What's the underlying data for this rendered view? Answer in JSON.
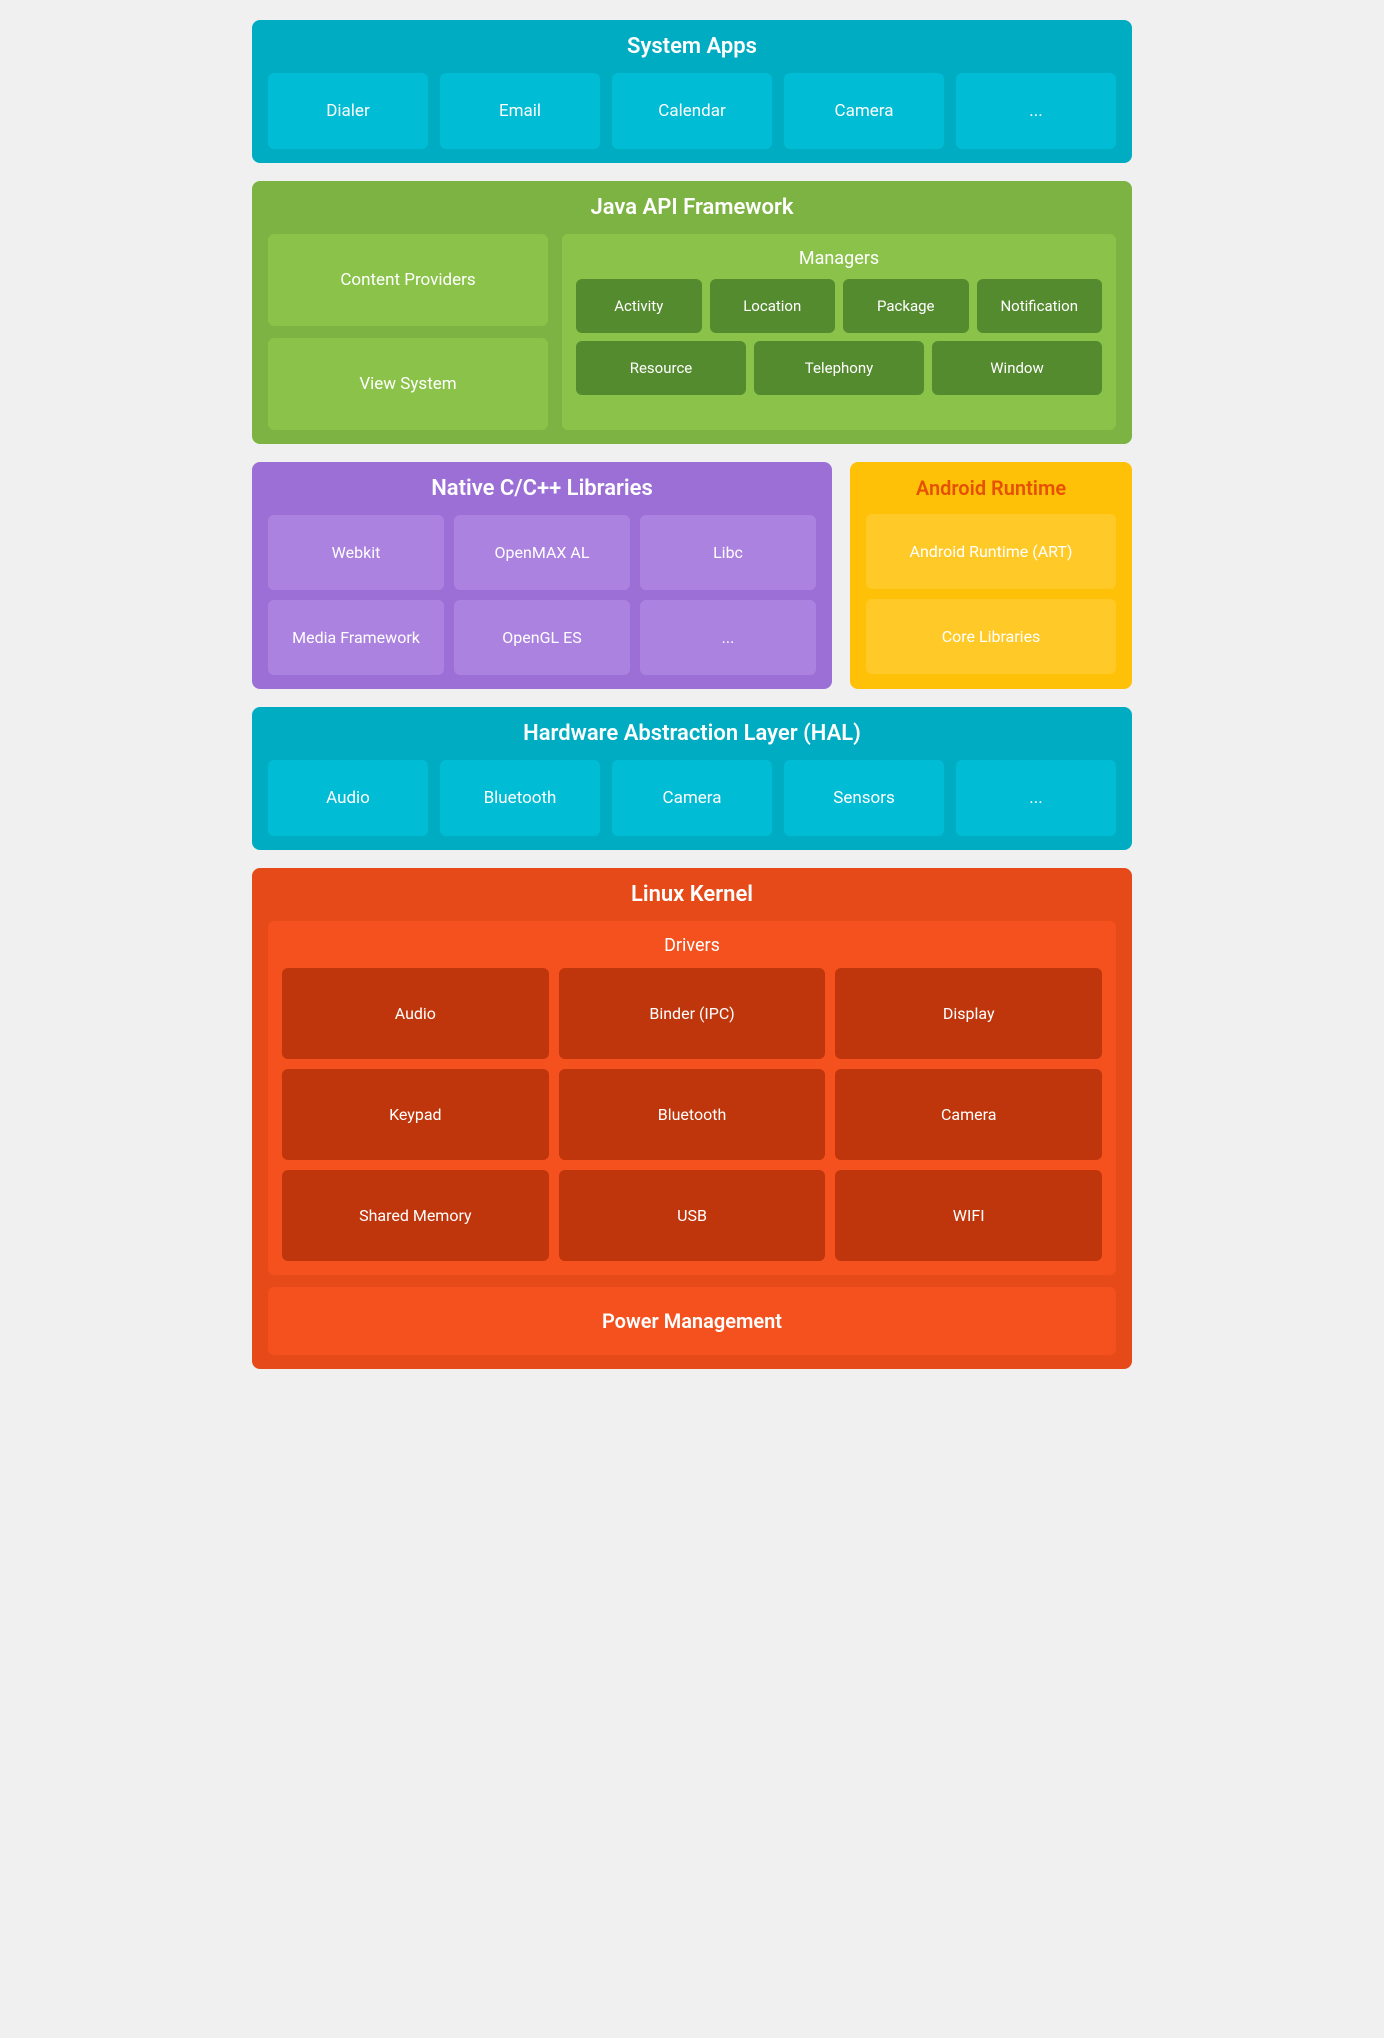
{
  "systemApps": {
    "title": "System Apps",
    "apps": [
      "Dialer",
      "Email",
      "Calendar",
      "Camera",
      "..."
    ]
  },
  "javaApi": {
    "title": "Java API Framework",
    "leftItems": [
      "Content Providers",
      "View System"
    ],
    "managers": {
      "title": "Managers",
      "row1": [
        "Activity",
        "Location",
        "Package",
        "Notification"
      ],
      "row2": [
        "Resource",
        "Telephony",
        "Window"
      ]
    }
  },
  "nativeLibs": {
    "title": "Native C/C++ Libraries",
    "row1": [
      "Webkit",
      "OpenMAX AL",
      "Libc"
    ],
    "row2": [
      "Media Framework",
      "OpenGL ES",
      "..."
    ]
  },
  "androidRuntime": {
    "title": "Android Runtime",
    "items": [
      "Android Runtime (ART)",
      "Core Libraries"
    ]
  },
  "hal": {
    "title": "Hardware Abstraction Layer (HAL)",
    "items": [
      "Audio",
      "Bluetooth",
      "Camera",
      "Sensors",
      "..."
    ]
  },
  "linuxKernel": {
    "title": "Linux Kernel",
    "drivers": {
      "title": "Drivers",
      "row1": [
        "Audio",
        "Binder (IPC)",
        "Display"
      ],
      "row2": [
        "Keypad",
        "Bluetooth",
        "Camera"
      ],
      "row3": [
        "Shared Memory",
        "USB",
        "WIFI"
      ]
    },
    "powerManagement": "Power Management"
  }
}
